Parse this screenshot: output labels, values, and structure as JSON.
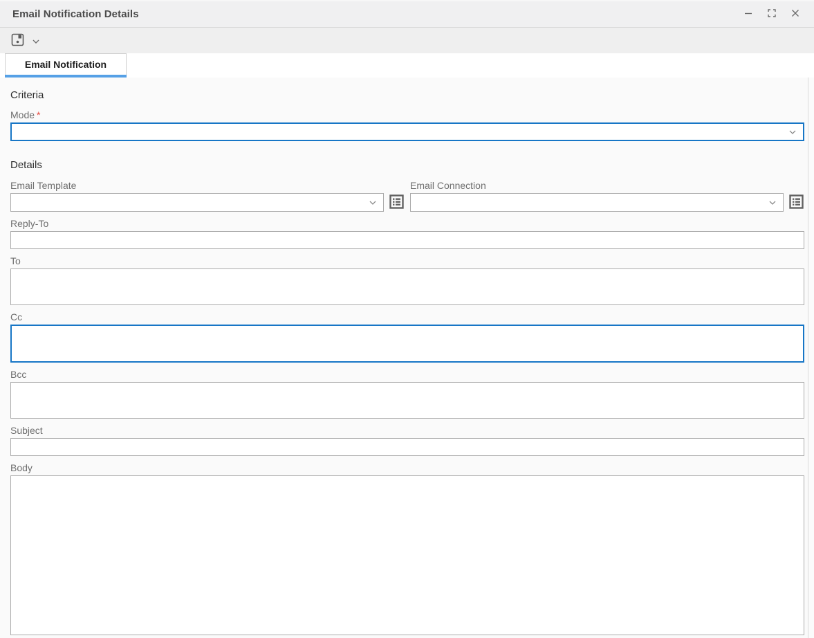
{
  "window": {
    "title": "Email Notification Details"
  },
  "icons": {
    "save": "floppy-disk",
    "save_menu": "chevron-down",
    "combo_arrow": "chevron-down",
    "lookup": "bullet-list-box",
    "minimize": "dash",
    "maximize": "expand-corners",
    "close": "x"
  },
  "tabs": [
    {
      "label": "Email Notification",
      "active": true
    }
  ],
  "form": {
    "criteria_heading": "Criteria",
    "details_heading": "Details",
    "required_marker": "*",
    "fields": {
      "mode": {
        "label": "Mode",
        "required": true,
        "value": ""
      },
      "email_template": {
        "label": "Email Template",
        "value": ""
      },
      "email_connection": {
        "label": "Email Connection",
        "value": ""
      },
      "reply_to": {
        "label": "Reply-To",
        "value": ""
      },
      "to": {
        "label": "To",
        "value": ""
      },
      "cc": {
        "label": "Cc",
        "value": "",
        "focused": true
      },
      "bcc": {
        "label": "Bcc",
        "value": ""
      },
      "subject": {
        "label": "Subject",
        "value": ""
      },
      "body": {
        "label": "Body",
        "value": ""
      }
    }
  },
  "colors": {
    "accent_blue": "#1776c6",
    "tab_underline": "#55a0e6",
    "required_red": "#e5483e",
    "titlebar_bg": "#f0f0f1",
    "toolbar_bg": "#efefef",
    "panel_bg": "#fafafa",
    "field_border": "#ababab"
  }
}
